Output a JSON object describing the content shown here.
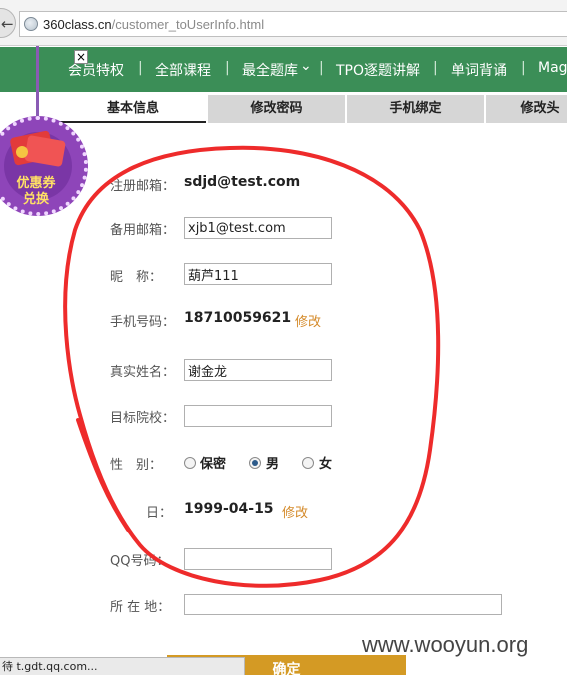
{
  "browser": {
    "url_host": "360class.cn",
    "url_path": "/customer_toUserInfo.html",
    "status_text": "待 t.gdt.qq.com..."
  },
  "nav": {
    "items": [
      "会员特权",
      "全部课程",
      "最全题库",
      "TPO逐题讲解",
      "单词背诵",
      "Mag"
    ],
    "separator": "|",
    "dropdown_mark": "⌄"
  },
  "tabs": [
    "基本信息",
    "修改密码",
    "手机绑定",
    "修改头"
  ],
  "coupon": {
    "line1": "优惠券",
    "line2": "兑换"
  },
  "form": {
    "email_label": "注册邮箱：",
    "email_value": "sdjd@test.com",
    "backup_email_label": "备用邮箱：",
    "backup_email_value": "xjb1@test.com",
    "nickname_label": "昵　称：",
    "nickname_value": "葫芦111",
    "phone_label": "手机号码：",
    "phone_value": "18710059621",
    "phone_edit": "修改",
    "realname_label": "真实姓名：",
    "realname_value": "谢金龙",
    "school_label": "目标院校：",
    "school_value": "",
    "gender_label": "性　别：",
    "gender_options": [
      "保密",
      "男",
      "女"
    ],
    "gender_selected": "男",
    "birthday_label": "日：",
    "birthday_value": "1999-04-15",
    "birthday_edit": "修改",
    "qq_label": "QQ号码：",
    "qq_value": "",
    "address_label": "所 在 地：",
    "address_value": "",
    "confirm_label": "确定"
  },
  "watermark": "www.wooyun.org",
  "colors": {
    "nav_bg": "#3b8e57",
    "annotation": "#ee2b2b",
    "accent": "#d49a24",
    "link": "#d48a2a"
  }
}
